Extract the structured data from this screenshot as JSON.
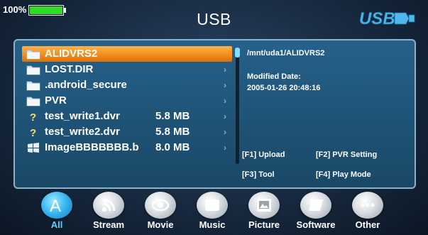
{
  "status": {
    "battery_percent_label": "100%",
    "battery_level": 1.0
  },
  "header": {
    "title": "USB",
    "logo_text": "USB"
  },
  "colors": {
    "selection": "#f08a1c",
    "panel": "#1f5376",
    "active_category": "#35b5ef",
    "battery": "#2fdc2a"
  },
  "files": [
    {
      "name": "ALIDVRS2",
      "size": "",
      "icon": "folder-icon",
      "selected": true
    },
    {
      "name": "LOST.DIR",
      "size": "",
      "icon": "folder-icon",
      "selected": false
    },
    {
      "name": ".android_secure",
      "size": "",
      "icon": "folder-icon",
      "selected": false
    },
    {
      "name": "PVR",
      "size": "",
      "icon": "folder-icon",
      "selected": false
    },
    {
      "name": "test_write1.dvr",
      "size": "5.8 MB",
      "icon": "unknown-file-icon",
      "selected": false
    },
    {
      "name": "test_write2.dvr",
      "size": "5.8 MB",
      "icon": "unknown-file-icon",
      "selected": false
    },
    {
      "name": "ImageBBBBBBB.b",
      "size": "8.0 MB",
      "icon": "windows-file-icon",
      "selected": false
    }
  ],
  "scroll_position": 0,
  "info": {
    "path": "/mnt/uda1/ALIDVRS2",
    "modified_label": "Modified Date:",
    "modified_value": "2005-01-26 20:48:16"
  },
  "function_keys": {
    "f1": "[F1] Upload",
    "f2": "[F2] PVR Setting",
    "f3": "[F3] Tool",
    "f4": "[F4] Play Mode"
  },
  "categories": [
    {
      "label": "All",
      "icon": "all-icon",
      "active": true
    },
    {
      "label": "Stream",
      "icon": "stream-icon",
      "active": false
    },
    {
      "label": "Movie",
      "icon": "movie-icon",
      "active": false
    },
    {
      "label": "Music",
      "icon": "music-icon",
      "active": false
    },
    {
      "label": "Picture",
      "icon": "picture-icon",
      "active": false
    },
    {
      "label": "Software",
      "icon": "software-icon",
      "active": false
    },
    {
      "label": "Other",
      "icon": "other-icon",
      "active": false
    }
  ]
}
